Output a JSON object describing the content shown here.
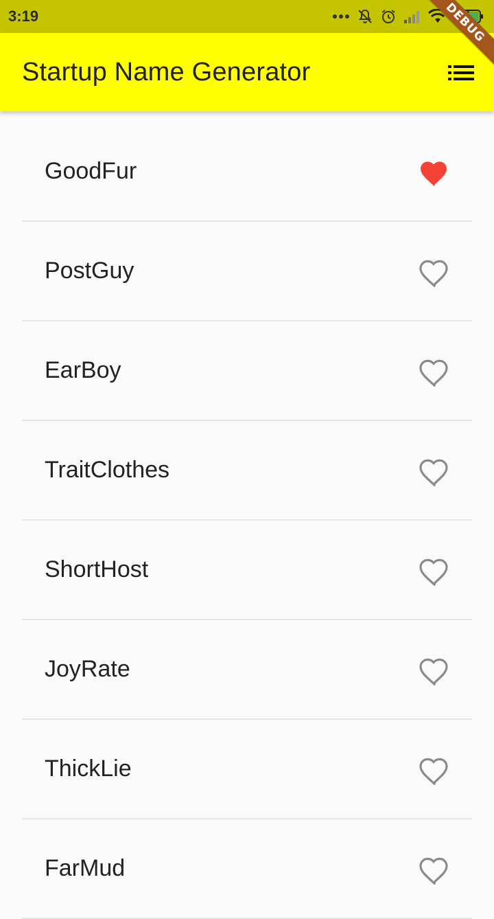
{
  "status_bar": {
    "time": "3:19",
    "icons": [
      "more-dots-icon",
      "notifications-off-icon",
      "alarm-icon",
      "signal-icon",
      "wifi-icon",
      "battery-charging-icon"
    ]
  },
  "app_bar": {
    "title": "Startup Name Generator",
    "action_icon": "list-icon",
    "debug_banner": "DEBUG"
  },
  "colors": {
    "app_bar": "#ffff00",
    "status_bar": "#c4c400",
    "favorite": "#f44336",
    "not_favorite": "#8a8a8a"
  },
  "names": [
    {
      "name": "GoodFur",
      "favorited": true
    },
    {
      "name": "PostGuy",
      "favorited": false
    },
    {
      "name": "EarBoy",
      "favorited": false
    },
    {
      "name": "TraitClothes",
      "favorited": false
    },
    {
      "name": "ShortHost",
      "favorited": false
    },
    {
      "name": "JoyRate",
      "favorited": false
    },
    {
      "name": "ThickLie",
      "favorited": false
    },
    {
      "name": "FarMud",
      "favorited": false
    }
  ]
}
